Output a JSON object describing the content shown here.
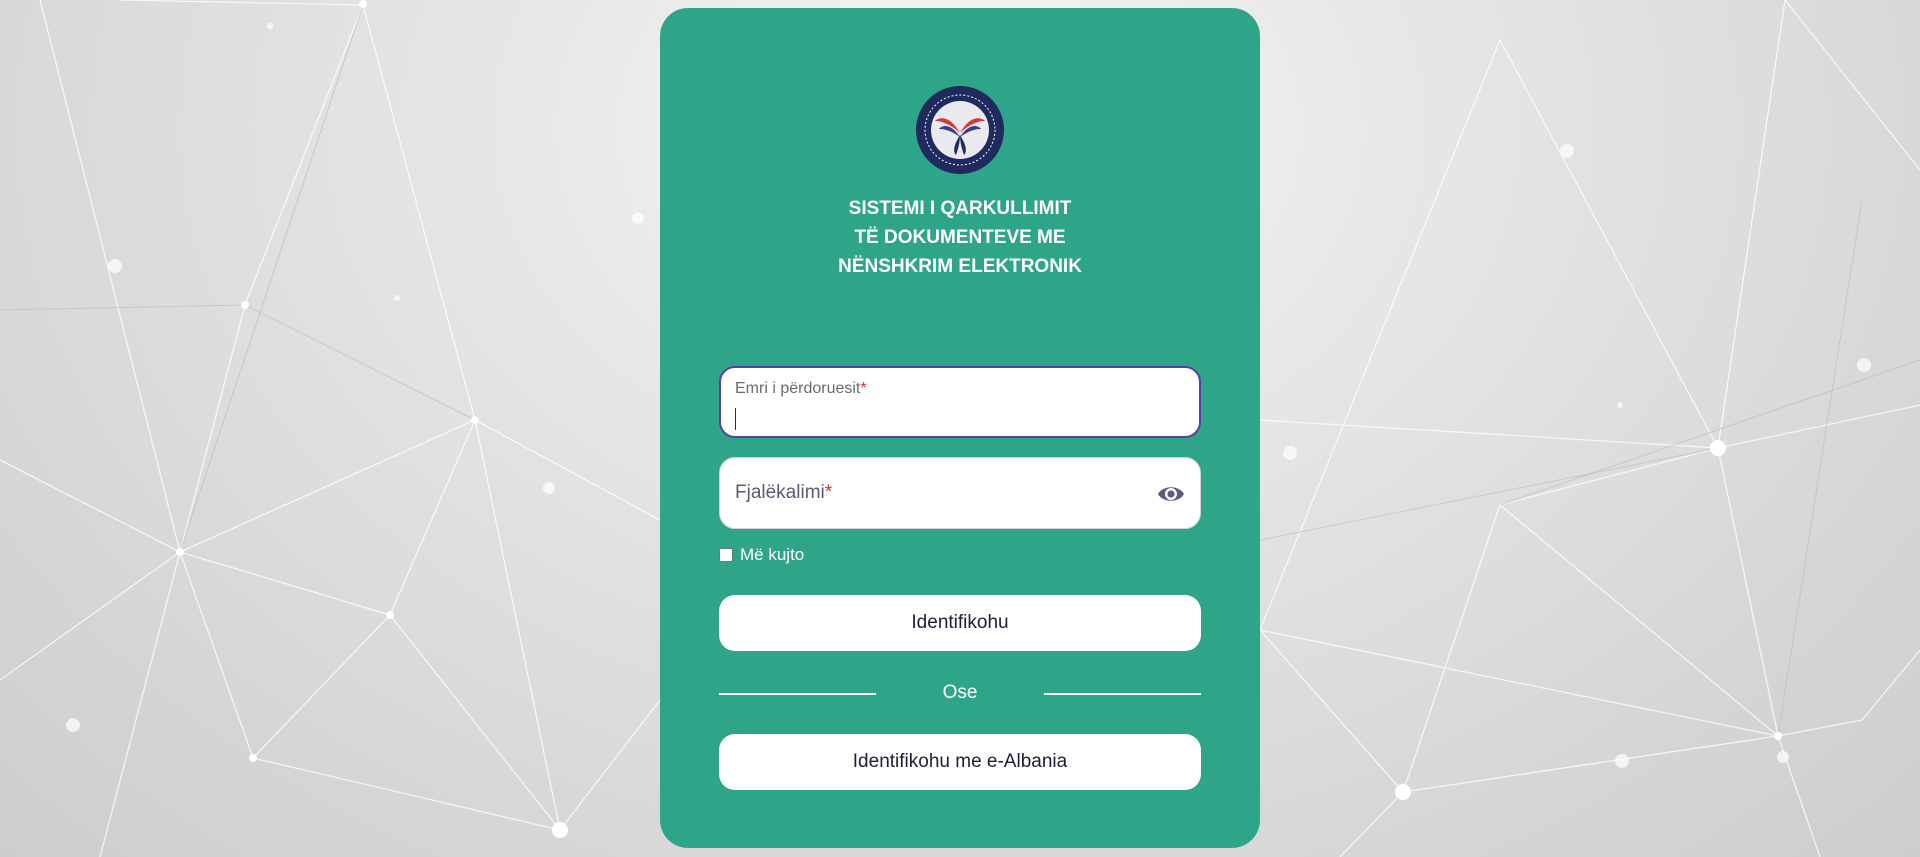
{
  "app": {
    "title_lines": [
      "SISTEMI I QARKULLIMIT",
      "TË DOKUMENTEVE ME",
      "NËNSHKRIM ELEKTRONIK"
    ]
  },
  "form": {
    "username": {
      "label": "Emri i përdoruesit",
      "required_mark": "*",
      "value": ""
    },
    "password": {
      "label": "Fjalëkalimi",
      "required_mark": "*",
      "value": ""
    },
    "remember_label": "Më kujto",
    "login_label": "Identifikohu",
    "divider_label": "Ose",
    "ealbania_label": "Identifikohu me e-Albania"
  },
  "icons": {
    "logo": "government-seal-logo",
    "password_toggle": "eye-icon"
  },
  "colors": {
    "card": "#2ea588",
    "focus_border": "#5b3fa0",
    "required": "#d32f2f",
    "logo_navy": "#1f2a5e"
  }
}
